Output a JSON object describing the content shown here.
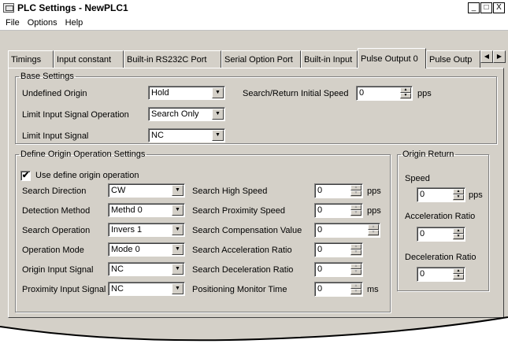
{
  "window": {
    "title": "PLC Settings - NewPLC1",
    "min": "_",
    "max": "□",
    "close": "X"
  },
  "menu": [
    "File",
    "Options",
    "Help"
  ],
  "tabs": [
    "Timings",
    "Input constant",
    "Built-in RS232C Port",
    "Serial Option Port",
    "Built-in Input",
    "Pulse Output 0",
    "Pulse Outp"
  ],
  "selected_tab": "Pulse Output 0",
  "base": {
    "legend": "Base Settings",
    "undefined_origin_label": "Undefined Origin",
    "undefined_origin_value": "Hold",
    "limit_op_label": "Limit Input Signal Operation",
    "limit_op_value": "Search Only",
    "limit_signal_label": "Limit Input Signal",
    "limit_signal_value": "NC",
    "initial_speed_label": "Search/Return Initial Speed",
    "initial_speed_value": "0",
    "initial_speed_unit": "pps"
  },
  "origin": {
    "legend": "Define Origin Operation Settings",
    "use_label": "Use define origin operation",
    "use_checked": "✔",
    "left": [
      {
        "label": "Search Direction",
        "value": "CW"
      },
      {
        "label": "Detection Method",
        "value": "Methd 0"
      },
      {
        "label": "Search Operation",
        "value": "Invers 1"
      },
      {
        "label": "Operation Mode",
        "value": "Mode 0"
      },
      {
        "label": "Origin Input Signal",
        "value": "NC"
      },
      {
        "label": "Proximity Input Signal",
        "value": "NC"
      }
    ],
    "right": [
      {
        "label": "Search High Speed",
        "value": "0",
        "unit": "pps"
      },
      {
        "label": "Search Proximity Speed",
        "value": "0",
        "unit": "pps"
      },
      {
        "label": "Search Compensation Value",
        "value": "0",
        "unit": ""
      },
      {
        "label": "Search Acceleration Ratio",
        "value": "0",
        "unit": ""
      },
      {
        "label": "Search Deceleration Ratio",
        "value": "0",
        "unit": ""
      },
      {
        "label": "Positioning Monitor Time",
        "value": "0",
        "unit": "ms"
      }
    ]
  },
  "ret": {
    "legend": "Origin Return",
    "speed_label": "Speed",
    "speed_value": "0",
    "speed_unit": "pps",
    "accel_label": "Acceleration Ratio",
    "accel_value": "0",
    "decel_label": "Deceleration Ratio",
    "decel_value": "0"
  },
  "icons": {
    "combo_arrow": "▼",
    "spin_up": "▲",
    "spin_down": "▼",
    "tab_left": "◀",
    "tab_right": "▶"
  }
}
